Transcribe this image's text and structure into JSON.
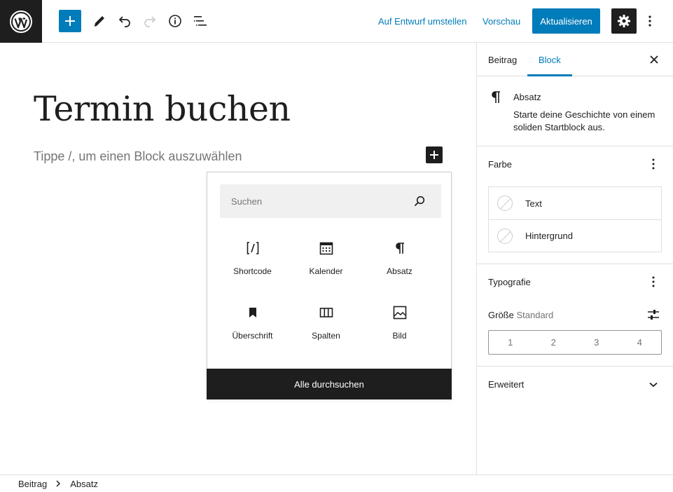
{
  "toolbar": {
    "switch_draft": "Auf Entwurf umstellen",
    "preview": "Vorschau",
    "update": "Aktualisieren",
    "icons": [
      "wordpress-logo",
      "add-block-icon",
      "edit-tools-icon",
      "undo-icon",
      "redo-icon",
      "info-icon",
      "list-view-icon",
      "settings-gear-icon",
      "more-menu-icon"
    ]
  },
  "editor": {
    "title": "Termin buchen",
    "placeholder": "Tippe /, um einen Block auszuwählen"
  },
  "inserter": {
    "search_placeholder": "Suchen",
    "blocks": [
      {
        "label": "Shortcode",
        "icon": "shortcode-icon"
      },
      {
        "label": "Kalender",
        "icon": "calendar-icon"
      },
      {
        "label": "Absatz",
        "icon": "paragraph-icon"
      },
      {
        "label": "Überschrift",
        "icon": "heading-bookmark-icon"
      },
      {
        "label": "Spalten",
        "icon": "columns-icon"
      },
      {
        "label": "Bild",
        "icon": "image-icon"
      }
    ],
    "browse_all": "Alle durchsuchen"
  },
  "sidebar": {
    "tabs": {
      "post": "Beitrag",
      "block": "Block"
    },
    "block_card": {
      "title": "Absatz",
      "description": "Starte deine Geschichte von einem soliden Startblock aus."
    },
    "color": {
      "title": "Farbe",
      "text": "Text",
      "background": "Hintergrund"
    },
    "typography": {
      "title": "Typografie",
      "size_label": "Größe",
      "size_value": "Standard",
      "sizes": [
        "1",
        "2",
        "3",
        "4"
      ]
    },
    "advanced": {
      "title": "Erweitert"
    }
  },
  "breadcrumb": {
    "root": "Beitrag",
    "current": "Absatz"
  },
  "colors": {
    "accent": "#007cba",
    "dark": "#1e1e1e",
    "border": "#e0e0e0",
    "muted": "#757575"
  }
}
